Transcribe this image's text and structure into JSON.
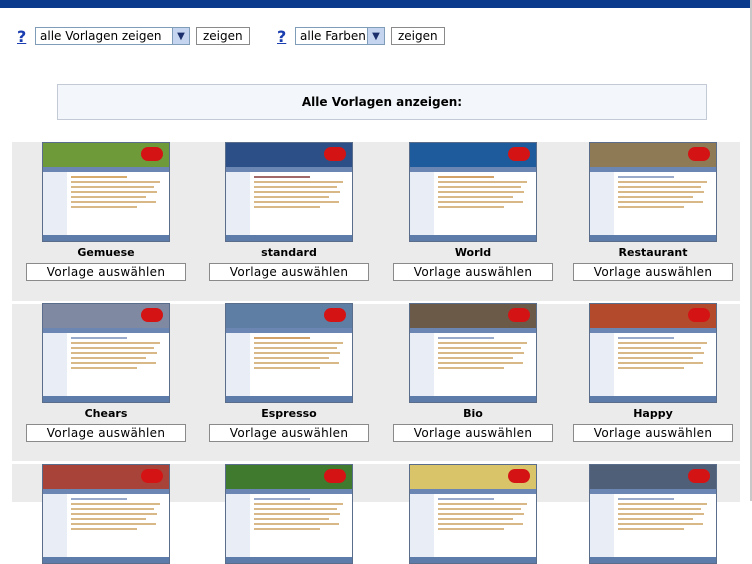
{
  "filters": {
    "help_glyph": "?",
    "template_select_value": "alle Vorlagen zeigen",
    "color_select_value": "alle Farben",
    "show_label": "zeigen"
  },
  "banner": {
    "title": "Alle Vorlagen anzeigen:"
  },
  "choose_label": "Vorlage auswählen",
  "templates": [
    {
      "name": "Gemuese",
      "header_color": "#6e9a3a",
      "accent": "#c8892e"
    },
    {
      "name": "standard",
      "header_color": "#2b4f86",
      "accent": "#7a2a2a"
    },
    {
      "name": "World",
      "header_color": "#1d5b9c",
      "accent": "#c07b2a"
    },
    {
      "name": "Restaurant",
      "header_color": "#8e7a55",
      "accent": "#6e86b3"
    },
    {
      "name": "Chears",
      "header_color": "#7f8aa2",
      "accent": "#6e86b3"
    },
    {
      "name": "Espresso",
      "header_color": "#5e7ea3",
      "accent": "#c07b2a"
    },
    {
      "name": "Bio",
      "header_color": "#6b5a48",
      "accent": "#6e86b3"
    },
    {
      "name": "Happy",
      "header_color": "#b44a2c",
      "accent": "#6e86b3"
    },
    {
      "name": "",
      "header_color": "#a8433a",
      "accent": "#6e86b3"
    },
    {
      "name": "",
      "header_color": "#3f7a2e",
      "accent": "#6e86b3"
    },
    {
      "name": "",
      "header_color": "#d9c46a",
      "accent": "#6e86b3"
    },
    {
      "name": "",
      "header_color": "#4f5f78",
      "accent": "#6e86b3"
    }
  ]
}
